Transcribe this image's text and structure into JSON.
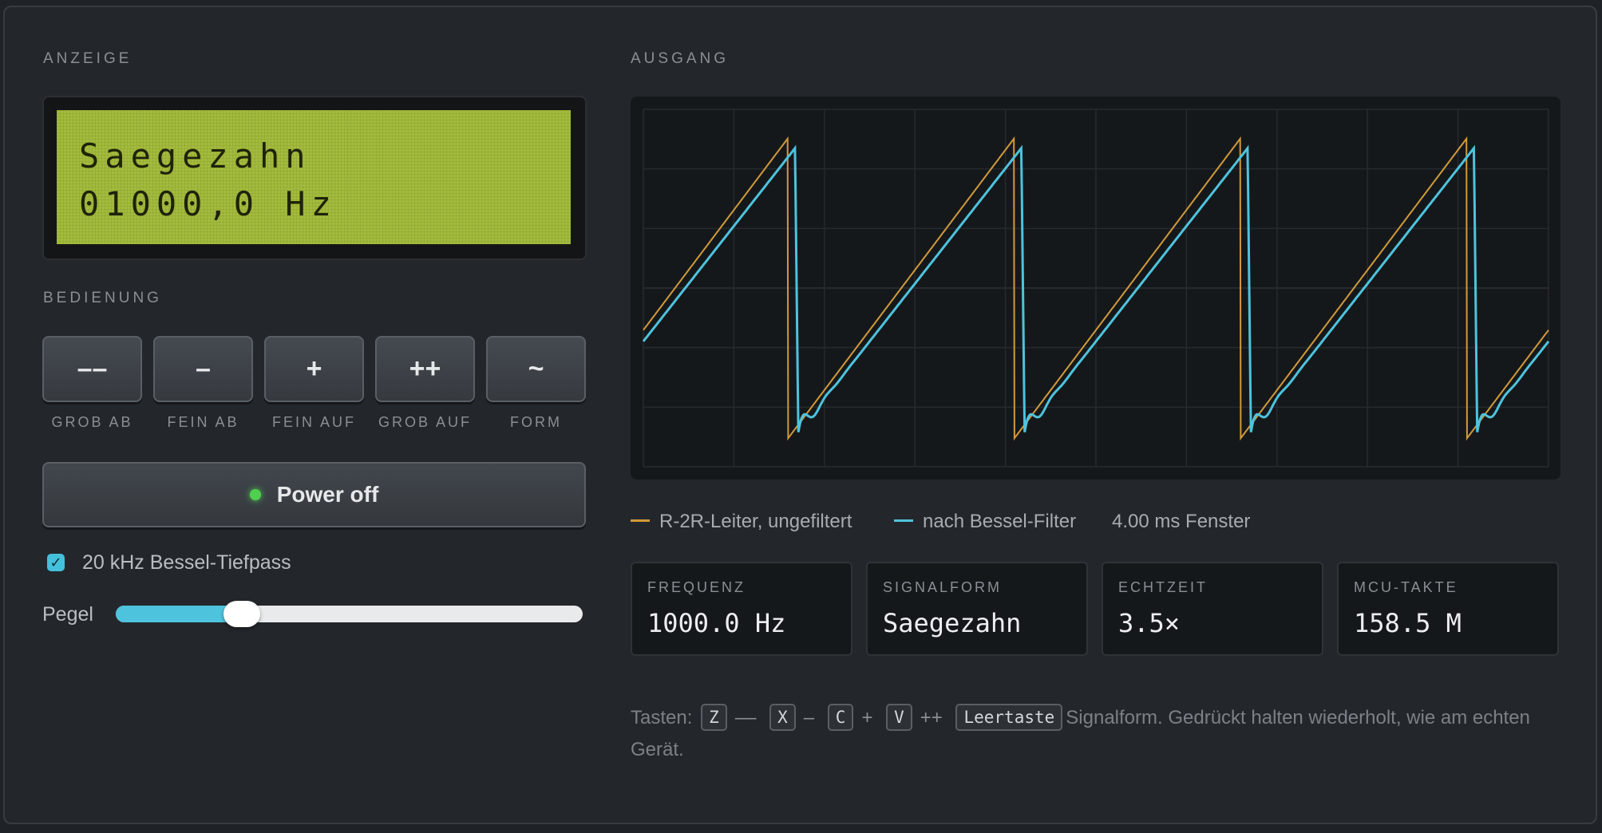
{
  "display": {
    "section_label": "ANZEIGE",
    "lcd_line1": "Saegezahn",
    "lcd_line2": "01000,0 Hz"
  },
  "controls": {
    "section_label": "BEDIENUNG",
    "buttons": [
      {
        "symbol": "––",
        "label": "GROB AB"
      },
      {
        "symbol": "–",
        "label": "FEIN AB"
      },
      {
        "symbol": "+",
        "label": "FEIN AUF"
      },
      {
        "symbol": "++",
        "label": "GROB AUF"
      },
      {
        "symbol": "~",
        "label": "FORM"
      }
    ],
    "power_label": "Power off",
    "filter_checked": true,
    "filter_label": "20 kHz Bessel-Tiefpass",
    "level_label": "Pegel",
    "level_fraction": 0.27
  },
  "output": {
    "section_label": "AUSGANG",
    "legend": {
      "raw_label": "R-2R-Leiter, ungefiltert",
      "filtered_label": "nach Bessel-Filter",
      "window_label": "4.00 ms Fenster"
    },
    "colors": {
      "raw": "#d09a3a",
      "filtered": "#4ec3dd",
      "grid": "#262a2e"
    },
    "stats": [
      {
        "label": "FREQUENZ",
        "value": "1000.0 Hz"
      },
      {
        "label": "SIGNALFORM",
        "value": "Saegezahn"
      },
      {
        "label": "ECHTZEIT",
        "value": "3.5×"
      },
      {
        "label": "MCU-TAKTE",
        "value": "158.5 M"
      }
    ]
  },
  "hint": {
    "prefix": "Tasten:",
    "keys": [
      {
        "key": "Z",
        "action": "––"
      },
      {
        "key": "X",
        "action": "–"
      },
      {
        "key": "C",
        "action": "+"
      },
      {
        "key": "V",
        "action": "++"
      },
      {
        "key": "Leertaste",
        "action": "Signalform. Gedrückt halten wiederholt, wie am echten Gerät."
      }
    ]
  },
  "chart_data": {
    "type": "line",
    "x_range_ms": [
      0,
      4
    ],
    "ylim": [
      -1,
      1
    ],
    "series": [
      {
        "name": "R-2R-Leiter, ungefiltert",
        "waveform": "sawtooth",
        "frequency_hz": 1000,
        "periods": 4
      },
      {
        "name": "nach Bessel-Filter",
        "waveform": "sawtooth",
        "frequency_hz": 1000,
        "periods": 4
      }
    ],
    "grid": true
  }
}
